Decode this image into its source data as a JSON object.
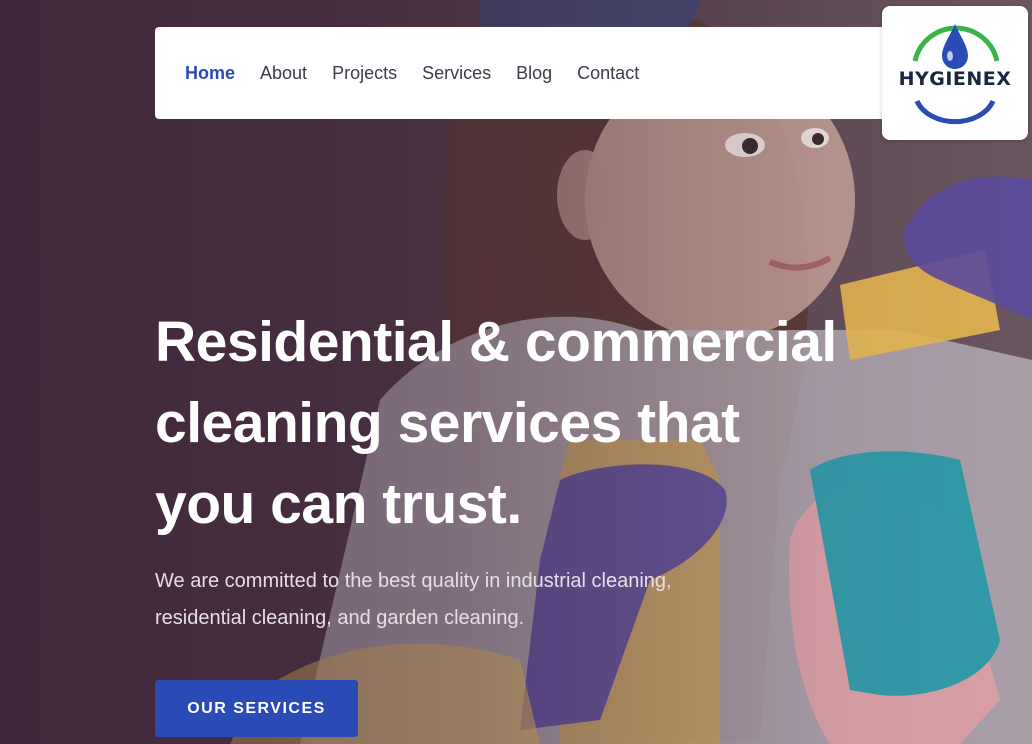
{
  "nav": {
    "items": [
      {
        "label": "Home",
        "active": true
      },
      {
        "label": "About",
        "active": false
      },
      {
        "label": "Projects",
        "active": false
      },
      {
        "label": "Services",
        "active": false
      },
      {
        "label": "Blog",
        "active": false
      },
      {
        "label": "Contact",
        "active": false
      }
    ]
  },
  "logo": {
    "text": "HYGIENEX"
  },
  "hero": {
    "headline_line1": "Residential & commercial",
    "headline_line2": "cleaning services that",
    "headline_line3": "you can trust.",
    "subtext_line1": "We are committed to the best quality in industrial cleaning,",
    "subtext_line2": "residential cleaning, and garden cleaning.",
    "cta_label": "OUR SERVICES"
  },
  "colors": {
    "accent": "#2a4bb5",
    "background": "#4a3040",
    "logo_green": "#3bb54a",
    "logo_blue": "#2a4bb5"
  }
}
